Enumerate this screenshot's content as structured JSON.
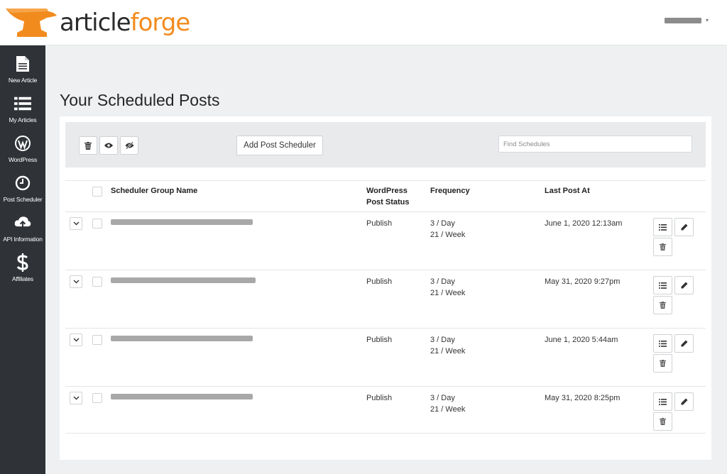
{
  "brand": {
    "name_part1": "article",
    "name_part2": "forge",
    "accent": "#f28b1e"
  },
  "header": {
    "user_caret": "▾"
  },
  "sidebar": {
    "items": [
      {
        "label": "New Article",
        "icon": "document-icon"
      },
      {
        "label": "My Articles",
        "icon": "list-icon"
      },
      {
        "label": "WordPress",
        "icon": "wordpress-icon"
      },
      {
        "label": "Post Scheduler",
        "icon": "clock-icon"
      },
      {
        "label": "API Information",
        "icon": "cloud-upload-icon"
      },
      {
        "label": "Affiliates",
        "icon": "dollar-icon"
      }
    ]
  },
  "main": {
    "title": "Your Scheduled Posts",
    "toolbar": {
      "add_label": "Add Post Scheduler",
      "search_placeholder": "Find Schedules"
    },
    "table": {
      "headers": {
        "group_name": "Scheduler Group Name",
        "wp_status_1": "WordPress",
        "wp_status_2": "Post Status",
        "frequency": "Frequency",
        "last_post": "Last Post At"
      },
      "rows": [
        {
          "status": "Publish",
          "freq_day": "3 / Day",
          "freq_week": "21 / Week",
          "last_post": "June 1, 2020 12:13am"
        },
        {
          "status": "Publish",
          "freq_day": "3 / Day",
          "freq_week": "21 / Week",
          "last_post": "May 31, 2020 9:27pm"
        },
        {
          "status": "Publish",
          "freq_day": "3 / Day",
          "freq_week": "21 / Week",
          "last_post": "June 1, 2020 5:44am"
        },
        {
          "status": "Publish",
          "freq_day": "3 / Day",
          "freq_week": "21 / Week",
          "last_post": "May 31, 2020 8:25pm"
        }
      ]
    }
  }
}
